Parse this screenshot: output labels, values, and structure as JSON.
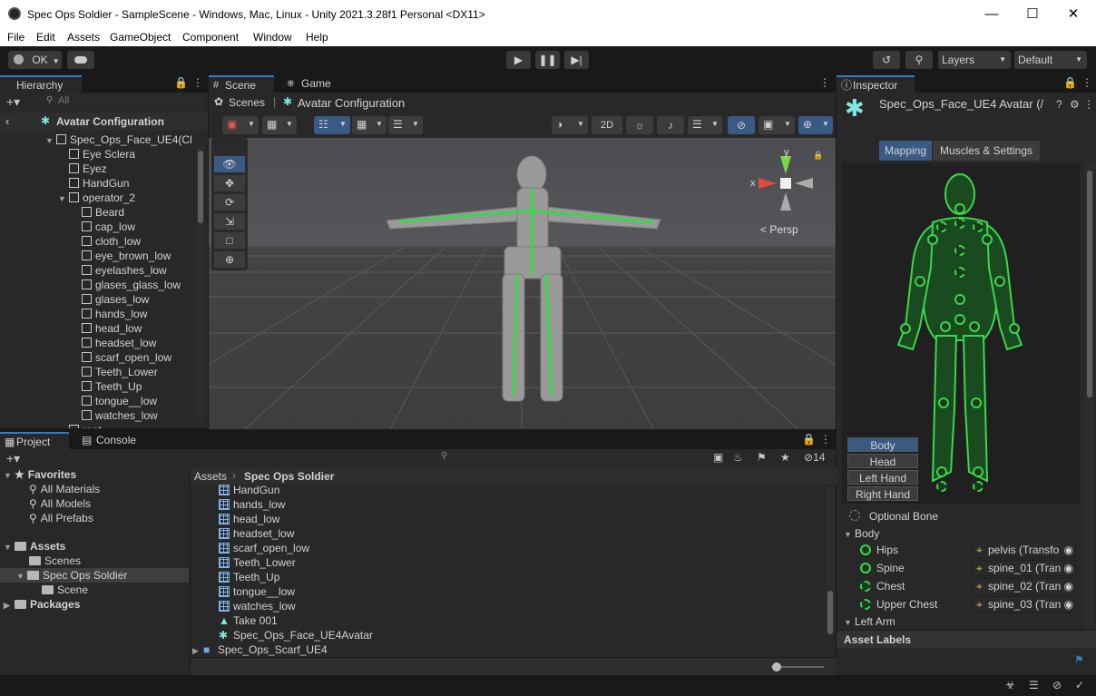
{
  "window": {
    "title": "Spec Ops Soldier - SampleScene - Windows, Mac, Linux - Unity 2021.3.28f1 Personal <DX11>"
  },
  "menu": [
    "File",
    "Edit",
    "Assets",
    "GameObject",
    "Component",
    "Window",
    "Help"
  ],
  "toolbar": {
    "account": "OK",
    "layers": "Layers",
    "layout": "Default"
  },
  "hierarchy": {
    "tab": "Hierarchy",
    "search_placeholder": "All",
    "header": "Avatar Configuration",
    "root": "Spec_Ops_Face_UE4(Cl",
    "items": [
      "Eye Sclera",
      "Eyez",
      "HandGun",
      "operator_2",
      "Beard",
      "cap_low",
      "cloth_low",
      "eye_brown_low",
      "eyelashes_low",
      "glases_glass_low",
      "glases_low",
      "hands_low",
      "head_low",
      "headset_low",
      "scarf_open_low",
      "Teeth_Lower",
      "Teeth_Up",
      "tongue__low",
      "watches_low",
      "root"
    ]
  },
  "scene": {
    "tabs": [
      "Scene",
      "Game"
    ],
    "breadcrumb_scenes": "Scenes",
    "breadcrumb_current": "Avatar Configuration",
    "btn_2d": "2D",
    "persp": "Persp",
    "axis_x": "x",
    "axis_y": "y"
  },
  "project": {
    "tabs": [
      "Project",
      "Console"
    ],
    "favorites_label": "Favorites",
    "favorites": [
      "All Materials",
      "All Models",
      "All Prefabs"
    ],
    "assets_label": "Assets",
    "assets_children": [
      "Scenes",
      "Spec Ops Soldier",
      "Scene"
    ],
    "packages_label": "Packages",
    "breadcrumb": [
      "Assets",
      "Spec Ops Soldier"
    ],
    "hidden_count": "14",
    "files": [
      "HandGun",
      "hands_low",
      "head_low",
      "headset_low",
      "scarf_open_low",
      "Teeth_Lower",
      "Teeth_Up",
      "tongue__low",
      "watches_low",
      "Take 001",
      "Spec_Ops_Face_UE4Avatar",
      "Spec_Ops_Scarf_UE4"
    ]
  },
  "inspector": {
    "tab": "Inspector",
    "title": "Spec_Ops_Face_UE4 Avatar (/",
    "mapping": "Mapping",
    "muscles": "Muscles & Settings",
    "body_tabs": [
      "Body",
      "Head",
      "Left Hand",
      "Right Hand"
    ],
    "optional_bone": "Optional Bone",
    "body_section": "Body",
    "bones": [
      {
        "name": "Hips",
        "value": "pelvis (Transfo"
      },
      {
        "name": "Spine",
        "value": "spine_01 (Tran"
      },
      {
        "name": "Chest",
        "value": "spine_02 (Tran"
      },
      {
        "name": "Upper Chest",
        "value": "spine_03 (Tran"
      }
    ],
    "left_arm": "Left Arm",
    "asset_labels": "Asset Labels"
  },
  "colors": {
    "accent": "#3a79bb",
    "bone_green": "#39d84a",
    "panel": "#282828"
  }
}
